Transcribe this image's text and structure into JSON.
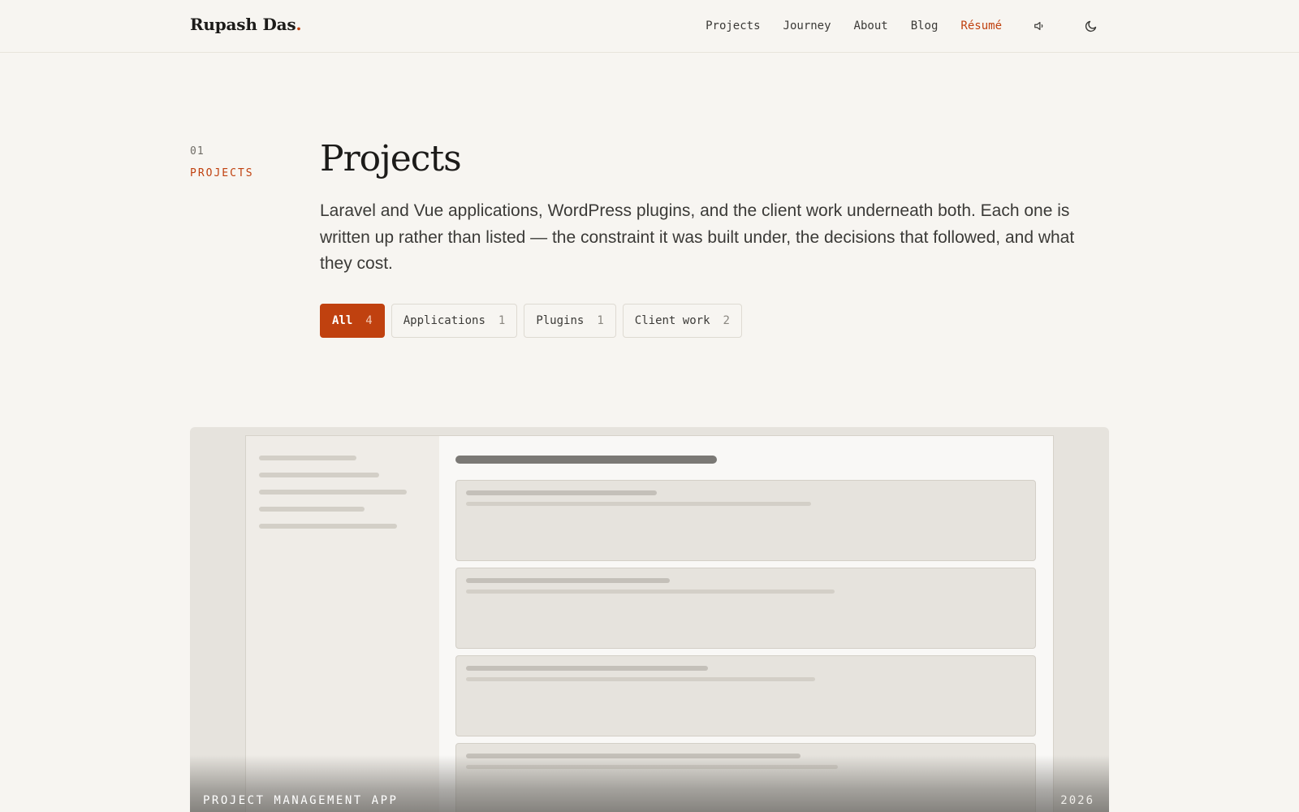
{
  "header": {
    "brand_name": "Rupash Das",
    "brand_dot": ".",
    "nav": [
      {
        "label": "Projects"
      },
      {
        "label": "Journey"
      },
      {
        "label": "About"
      },
      {
        "label": "Blog"
      },
      {
        "label": "Résumé"
      }
    ],
    "icons": {
      "sound": "speaker-icon",
      "theme": "moon-icon"
    }
  },
  "section": {
    "number": "01",
    "label": "PROJECTS",
    "title": "Projects",
    "intro": "Laravel and Vue applications, WordPress plugins, and the client work underneath both. Each one is written up rather than listed — the constraint it was built under, the decisions that followed, and what they cost."
  },
  "filters": [
    {
      "label": "All",
      "count": "4",
      "active": true
    },
    {
      "label": "Applications",
      "count": "1",
      "active": false
    },
    {
      "label": "Plugins",
      "count": "1",
      "active": false
    },
    {
      "label": "Client work",
      "count": "2",
      "active": false
    }
  ],
  "project_card": {
    "title": "PROJECT MANAGEMENT APP",
    "year": "2026"
  },
  "colors": {
    "accent": "#c0410f",
    "background": "#f7f5f1",
    "text": "#1c1b19"
  }
}
